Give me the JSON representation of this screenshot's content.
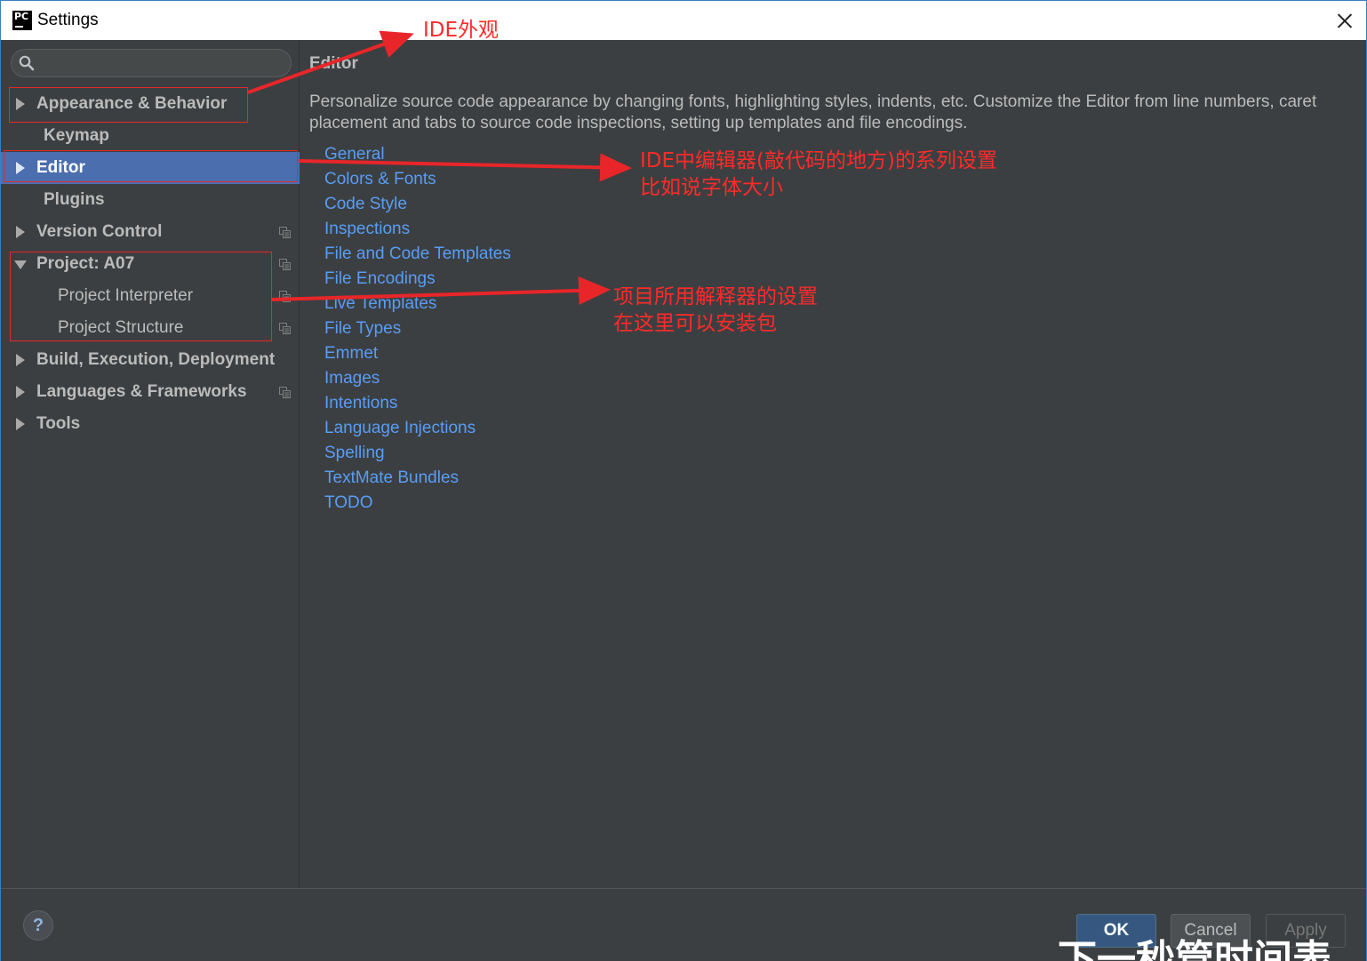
{
  "window": {
    "title": "Settings",
    "app_icon": "PC"
  },
  "sidebar": {
    "search_placeholder": "",
    "items": [
      {
        "label": "Appearance & Behavior",
        "bold": true,
        "arrow": "right",
        "indent": 0,
        "copy_icon": false,
        "selected": false
      },
      {
        "label": "Keymap",
        "bold": true,
        "arrow": "none",
        "indent": 1,
        "copy_icon": false,
        "selected": false
      },
      {
        "label": "Editor",
        "bold": true,
        "arrow": "right",
        "indent": 0,
        "copy_icon": false,
        "selected": true
      },
      {
        "label": "Plugins",
        "bold": true,
        "arrow": "none",
        "indent": 1,
        "copy_icon": false,
        "selected": false
      },
      {
        "label": "Version Control",
        "bold": true,
        "arrow": "right",
        "indent": 0,
        "copy_icon": true,
        "selected": false
      },
      {
        "label": "Project: A07",
        "bold": true,
        "arrow": "down",
        "indent": 0,
        "copy_icon": true,
        "selected": false
      },
      {
        "label": "Project Interpreter",
        "bold": false,
        "arrow": "none",
        "indent": 2,
        "copy_icon": true,
        "selected": false
      },
      {
        "label": "Project Structure",
        "bold": false,
        "arrow": "none",
        "indent": 2,
        "copy_icon": true,
        "selected": false
      },
      {
        "label": "Build, Execution, Deployment",
        "bold": true,
        "arrow": "right",
        "indent": 0,
        "copy_icon": false,
        "selected": false
      },
      {
        "label": "Languages & Frameworks",
        "bold": true,
        "arrow": "right",
        "indent": 0,
        "copy_icon": true,
        "selected": false
      },
      {
        "label": "Tools",
        "bold": true,
        "arrow": "right",
        "indent": 0,
        "copy_icon": false,
        "selected": false
      }
    ]
  },
  "content": {
    "title": "Editor",
    "description": "Personalize source code appearance by changing fonts, highlighting styles, indents, etc. Customize the Editor from line numbers, caret placement and tabs to source code inspections, setting up templates and file encodings.",
    "links": [
      "General",
      "Colors & Fonts",
      "Code Style",
      "Inspections",
      "File and Code Templates",
      "File Encodings",
      "Live Templates",
      "File Types",
      "Emmet",
      "Images",
      "Intentions",
      "Language Injections",
      "Spelling",
      "TextMate Bundles",
      "TODO"
    ]
  },
  "footer": {
    "help_label": "?",
    "ok_label": "OK",
    "cancel_label": "Cancel",
    "apply_label": "Apply"
  },
  "annotations": {
    "appearance_note": "IDE外观",
    "editor_note_line1": "IDE中编辑器(敲代码的地方)的系列设置",
    "editor_note_line2": "比如说字体大小",
    "interpreter_note_line1": "项目所用解释器的设置",
    "interpreter_note_line2": "在这里可以安装包",
    "color": "#e8262a"
  },
  "watermark_text": "下一秒管时间表"
}
